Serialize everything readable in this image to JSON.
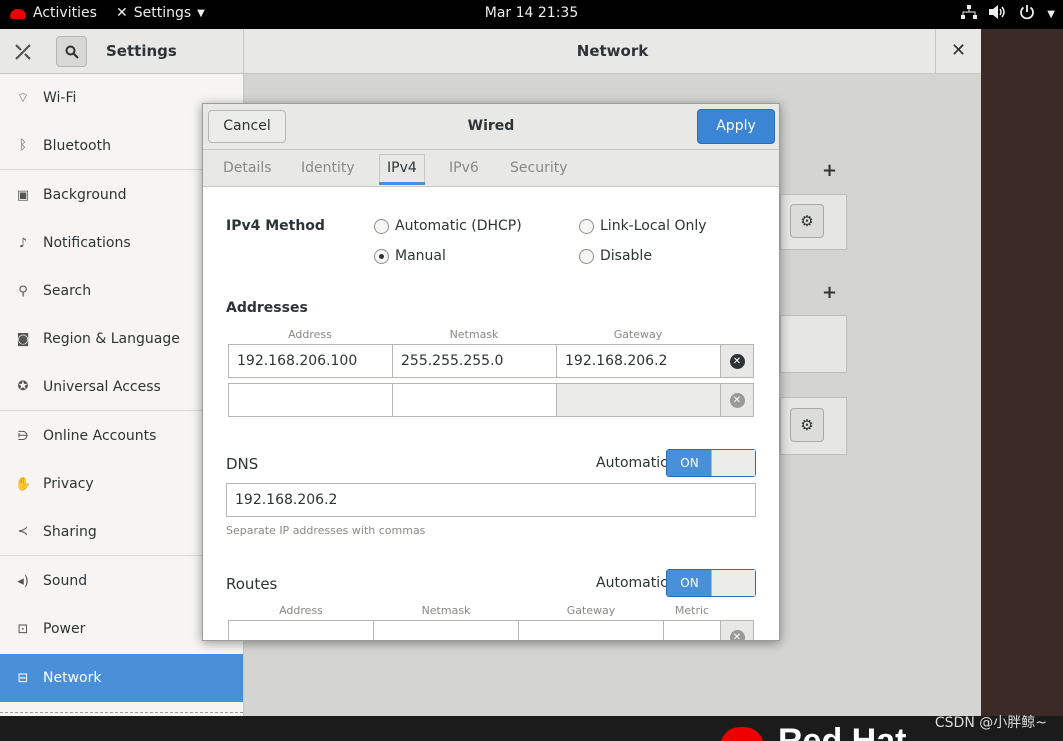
{
  "topbar": {
    "activities": "Activities",
    "app_menu": "Settings",
    "clock": "Mar 14  21:35",
    "icons": [
      "network-icon",
      "volume-icon",
      "power-icon"
    ]
  },
  "settings": {
    "sidebar_title": "Settings",
    "panel_title": "Network",
    "sidebar_items": [
      {
        "label": "Wi-Fi",
        "icon": "wifi-icon"
      },
      {
        "label": "Bluetooth",
        "icon": "bluetooth-icon"
      },
      {
        "label": "Background",
        "icon": "background-icon"
      },
      {
        "label": "Notifications",
        "icon": "bell-icon"
      },
      {
        "label": "Search",
        "icon": "search-icon"
      },
      {
        "label": "Region & Language",
        "icon": "camera-icon"
      },
      {
        "label": "Universal Access",
        "icon": "accessibility-icon"
      },
      {
        "label": "Online Accounts",
        "icon": "online-accounts-icon"
      },
      {
        "label": "Privacy",
        "icon": "hand-icon"
      },
      {
        "label": "Sharing",
        "icon": "share-icon"
      },
      {
        "label": "Sound",
        "icon": "speaker-icon"
      },
      {
        "label": "Power",
        "icon": "power-plug-icon"
      },
      {
        "label": "Network",
        "icon": "network-icon"
      }
    ],
    "selected": "Network"
  },
  "dialog": {
    "title": "Wired",
    "cancel": "Cancel",
    "apply": "Apply",
    "tabs": [
      "Details",
      "Identity",
      "IPv4",
      "IPv6",
      "Security"
    ],
    "active_tab": "IPv4",
    "ipv4_method_label": "IPv4 Method",
    "methods": {
      "automatic": "Automatic (DHCP)",
      "link_local": "Link-Local Only",
      "manual": "Manual",
      "disable": "Disable"
    },
    "selected_method": "Manual",
    "addresses_label": "Addresses",
    "address_cols": [
      "Address",
      "Netmask",
      "Gateway"
    ],
    "address_rows": [
      {
        "address": "192.168.206.100",
        "netmask": "255.255.255.0",
        "gateway": "192.168.206.2"
      },
      {
        "address": "",
        "netmask": "",
        "gateway": ""
      }
    ],
    "dns_label": "DNS",
    "automatic_label": "Automatic",
    "toggle_on": "ON",
    "dns_value": "192.168.206.2",
    "dns_hint": "Separate IP addresses with commas",
    "routes_label": "Routes",
    "route_cols": [
      "Address",
      "Netmask",
      "Gateway",
      "Metric"
    ]
  },
  "desktop": {
    "brand": "Red Hat",
    "watermark": "CSDN @小胖鲸~"
  },
  "colors": {
    "accent": "#4a90d9",
    "apply_button": "#3c84d4",
    "redhat": "#ee0000"
  }
}
